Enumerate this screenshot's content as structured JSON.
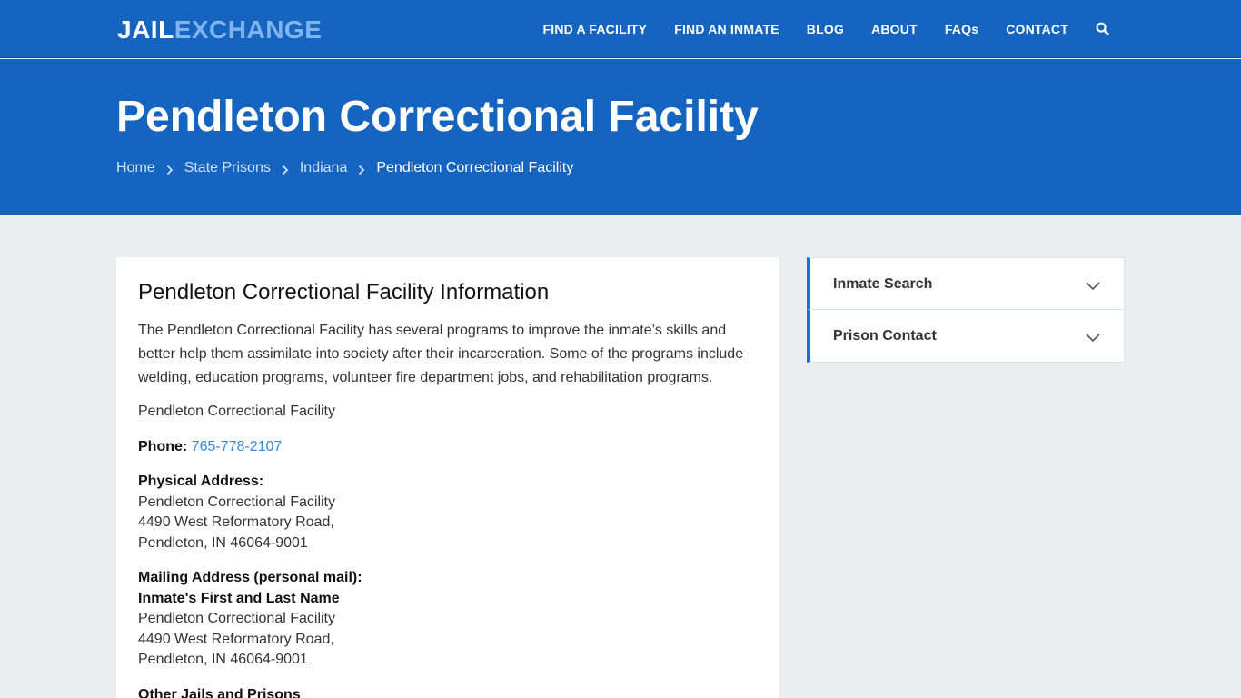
{
  "header": {
    "logo_part1": "JAIL",
    "logo_part2": "EXCHANGE",
    "nav": [
      {
        "label": "FIND A FACILITY"
      },
      {
        "label": "FIND AN INMATE"
      },
      {
        "label": "BLOG"
      },
      {
        "label": "ABOUT"
      },
      {
        "label": "FAQs"
      },
      {
        "label": "CONTACT"
      }
    ],
    "search_icon": "search-icon"
  },
  "hero": {
    "title": "Pendleton Correctional Facility",
    "breadcrumb": [
      {
        "label": "Home"
      },
      {
        "label": "State Prisons"
      },
      {
        "label": "Indiana"
      },
      {
        "label": "Pendleton Correctional Facility"
      }
    ]
  },
  "main": {
    "heading": "Pendleton Correctional Facility Information",
    "intro": "The Pendleton Correctional Facility has several programs to improve the inmate’s skills and better help them assimilate into society after their incarceration. Some of the programs include welding, education programs, volunteer fire department jobs, and rehabilitation programs.",
    "facility_name": "Pendleton Correctional Facility",
    "phone_label": "Phone:",
    "phone": "765-778-2107",
    "physical_label": "Physical Address:",
    "physical_lines": [
      "Pendleton Correctional Facility",
      "4490 West Reformatory Road,",
      "Pendleton, IN 46064-9001"
    ],
    "mailing_label": "Mailing Address (personal mail):",
    "mailing_name": "Inmate's First and Last Name",
    "mailing_lines": [
      "Pendleton Correctional Facility",
      "4490 West Reformatory Road,",
      "Pendleton, IN 46064-9001"
    ],
    "other_heading": "Other Jails and Prisons"
  },
  "sidebar": {
    "accordions": [
      {
        "label": "Inmate Search"
      },
      {
        "label": "Prison Contact"
      }
    ]
  },
  "colors": {
    "primary": "#1565c0",
    "accent": "#1f6fd1",
    "link": "#3a87d8",
    "logo_accent": "#7fb5ef",
    "background": "#ebeef1"
  }
}
